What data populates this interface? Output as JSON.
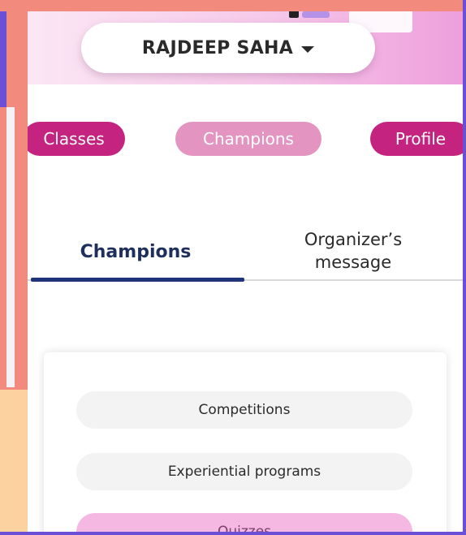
{
  "header": {
    "user_name": "RAJDEEP SAHA"
  },
  "nav_pills": [
    {
      "label": "Classes",
      "color": "#c4247f"
    },
    {
      "label": "Champions",
      "color": "#e394c1"
    },
    {
      "label": "Profile",
      "color": "#c4247f"
    }
  ],
  "tabs": [
    {
      "label": "Champions",
      "active": true
    },
    {
      "label_line1": "Organizer’s",
      "label_line2": "message",
      "active": false
    }
  ],
  "menu": [
    {
      "label": "Competitions",
      "selected": false
    },
    {
      "label": "Experiential programs",
      "selected": false
    },
    {
      "label": "Quizzes",
      "selected": true
    }
  ],
  "colors": {
    "accent_magenta": "#c4247f",
    "accent_pink": "#e394c1",
    "tab_indicator": "#1f3378",
    "selected_item": "#f4b8e2"
  }
}
